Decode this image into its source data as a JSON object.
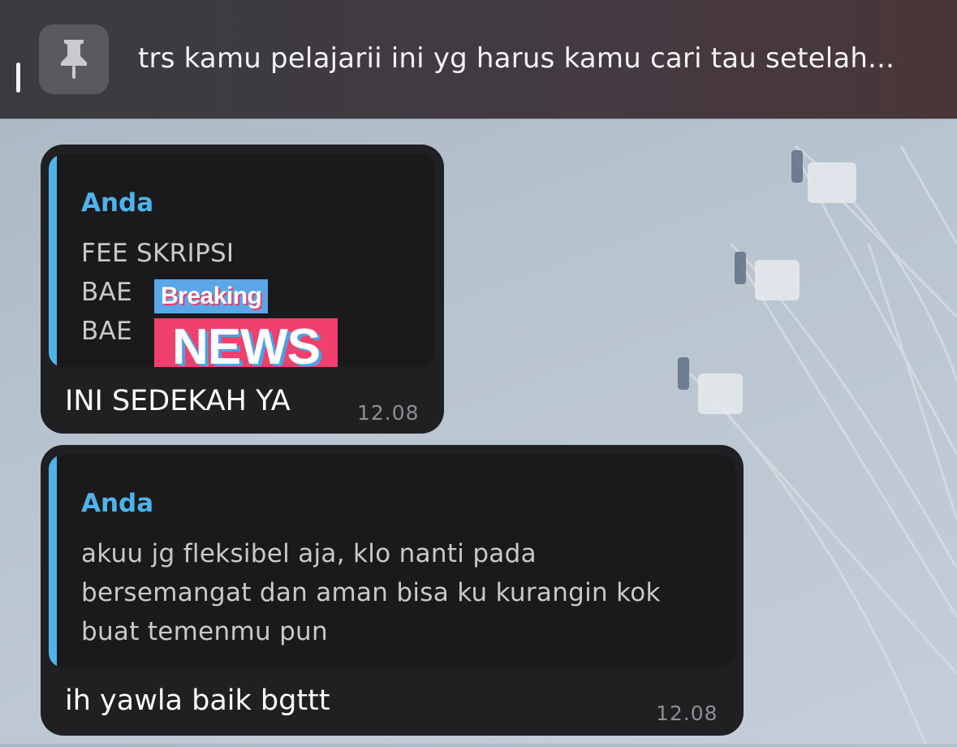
{
  "pinned": {
    "text": "trs kamu pelajarii ini yg harus kamu cari tau setelah..."
  },
  "messages": [
    {
      "reply": {
        "name": "Anda",
        "lines": [
          "FEE SKRIPSI",
          "BAE",
          "BAE"
        ]
      },
      "sticker": {
        "top": "Breaking",
        "bottom": "NEWS"
      },
      "text": "INI SEDEKAH YA",
      "time": "12.08"
    },
    {
      "reply": {
        "name": "Anda",
        "lines": [
          "akuu jg fleksibel aja, klo nanti pada",
          "bersemangat dan aman bisa ku kurangin kok",
          "buat temenmu pun"
        ]
      },
      "text": "ih yawla baik bgttt",
      "time": "12.08"
    }
  ],
  "colors": {
    "accent": "#4fb3ea",
    "bubble": "#202022",
    "sticker_blue": "#5aa6e6",
    "sticker_pink": "#f0406e"
  },
  "icons": {
    "pin": "pin-icon"
  }
}
